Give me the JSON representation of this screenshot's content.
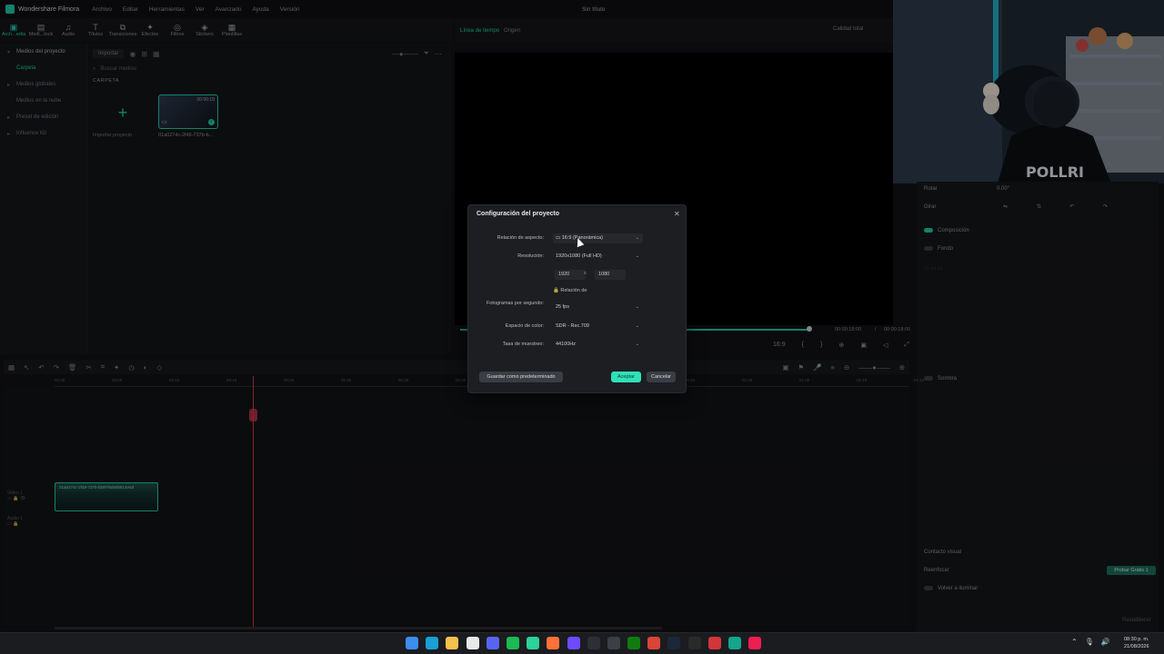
{
  "titlebar": {
    "app_name": "Wondershare Filmora",
    "menu": [
      "Archivo",
      "Editar",
      "Herramientas",
      "Ver",
      "Avanzado",
      "Ayuda",
      "Versión"
    ],
    "doc_title": "Sin título"
  },
  "toolbar": {
    "tools": [
      {
        "label": "Arch...edia",
        "icon": "folder-icon",
        "active": true
      },
      {
        "label": "Medi...tock",
        "icon": "stock-media-icon",
        "active": false
      },
      {
        "label": "Audio",
        "icon": "music-note-icon",
        "active": false
      },
      {
        "label": "Títulos",
        "icon": "text-icon",
        "active": false
      },
      {
        "label": "Transiciones",
        "icon": "transition-icon",
        "active": false
      },
      {
        "label": "Efectos",
        "icon": "effects-icon",
        "active": false
      },
      {
        "label": "Filtros",
        "icon": "filter-icon",
        "active": false
      },
      {
        "label": "Stickers",
        "icon": "sticker-icon",
        "active": false
      },
      {
        "label": "Plantillas",
        "icon": "template-icon",
        "active": false
      }
    ]
  },
  "sidebar": {
    "items": [
      {
        "label": "Medios del proyecto",
        "kind": "head"
      },
      {
        "label": "Carpeta",
        "kind": "active"
      },
      {
        "label": "Medios globales",
        "kind": "item"
      },
      {
        "label": "Medios en la nube",
        "kind": "item"
      },
      {
        "label": "Preset de edición",
        "kind": "item"
      },
      {
        "label": "Influence Kit",
        "kind": "item"
      }
    ]
  },
  "media": {
    "import_dropdown": "Importar",
    "search_placeholder": "Buscar medios",
    "folder_label": "CARPETA",
    "import_label": "Importar proyecto",
    "clip_label": "01a0274c-2f48-737b-b...",
    "clip_duration": "00:00:18"
  },
  "preview": {
    "tab_timeline": "Línea de tiempo",
    "tab_origin": "Origen",
    "quality": "Calidad total",
    "time_current": "00:00:18:00",
    "time_sep": "/",
    "time_total": "00:00:18:00",
    "progress": 1.0,
    "ratio": "16:9"
  },
  "inspector": {
    "rotate": "Rotar",
    "rotate_value": "0.00°",
    "flip": "Girar",
    "composition": "Composición",
    "background": "Fondo",
    "shadow": "Sombra",
    "visual_contact": "Contacto visual",
    "reinforce": "Reenfocar",
    "relight": "Volver a iluminar",
    "try_label": "Probar Gratis 1",
    "reset": "Restablecer"
  },
  "timeline": {
    "ticks": [
      "00:00",
      "00:05",
      "00:10",
      "00:15",
      "00:20",
      "00:25",
      "00:30",
      "00:35",
      "00:40",
      "00:45",
      "00:50",
      "00:55",
      "01:00",
      "01:05",
      "01:10",
      "01:15"
    ],
    "video_clip_label": "01a0274c-2f48-737b-bb9f-f8de5b814e6d",
    "track_video": "Video 1",
    "track_audio": "Audio 1"
  },
  "dialog": {
    "title": "Configuración del proyecto",
    "aspect_label": "Relación de aspecto:",
    "aspect_value": "16:9 (Panorámica)",
    "resolution_label": "Resolución:",
    "resolution_value": "1920x1080 (Full HD)",
    "res_width": "1920",
    "res_x": "x",
    "res_height": "1080",
    "lock_label": "Relación de",
    "fps_label": "Fotogramas por segundo:",
    "fps_value": "25 fps",
    "color_label": "Espacio de color:",
    "color_value": "SDR - Rec.709",
    "sample_label": "Tasa de muestreo:",
    "sample_value": "44100Hz",
    "save_default": "Guardar como predeterminado",
    "accept": "Aceptar",
    "cancel": "Cancelar"
  },
  "taskbar": {
    "time": "08:30 p. m.",
    "date": "21/08/2026",
    "apps": [
      {
        "icon": "windows-start-icon",
        "color": "#3b8ef0"
      },
      {
        "icon": "edge-icon",
        "color": "#1a9fd6"
      },
      {
        "icon": "file-explorer-icon",
        "color": "#f2c14e"
      },
      {
        "icon": "calendar-icon",
        "color": "#e8e8e8"
      },
      {
        "icon": "discord-icon",
        "color": "#5865f2"
      },
      {
        "icon": "spotify-icon",
        "color": "#1db954"
      },
      {
        "icon": "notes-icon",
        "color": "#2bd29a"
      },
      {
        "icon": "firefox-icon",
        "color": "#ff7139"
      },
      {
        "icon": "proton-icon",
        "color": "#6d4aff"
      },
      {
        "icon": "obs-icon",
        "color": "#2d2f36"
      },
      {
        "icon": "media-icon",
        "color": "#3c3f46"
      },
      {
        "icon": "xbox-icon",
        "color": "#107c10"
      },
      {
        "icon": "chrome-icon",
        "color": "#db4437"
      },
      {
        "icon": "steam-icon",
        "color": "#1b2838"
      },
      {
        "icon": "epic-icon",
        "color": "#2a2a2a"
      },
      {
        "icon": "riot-icon",
        "color": "#d13639"
      },
      {
        "icon": "filmora-icon",
        "color": "#14a58b"
      },
      {
        "icon": "tiktok-icon",
        "color": "#ee1d52"
      }
    ]
  },
  "colors": {
    "accent": "#1fc7a6",
    "playhead": "#d1384d"
  }
}
